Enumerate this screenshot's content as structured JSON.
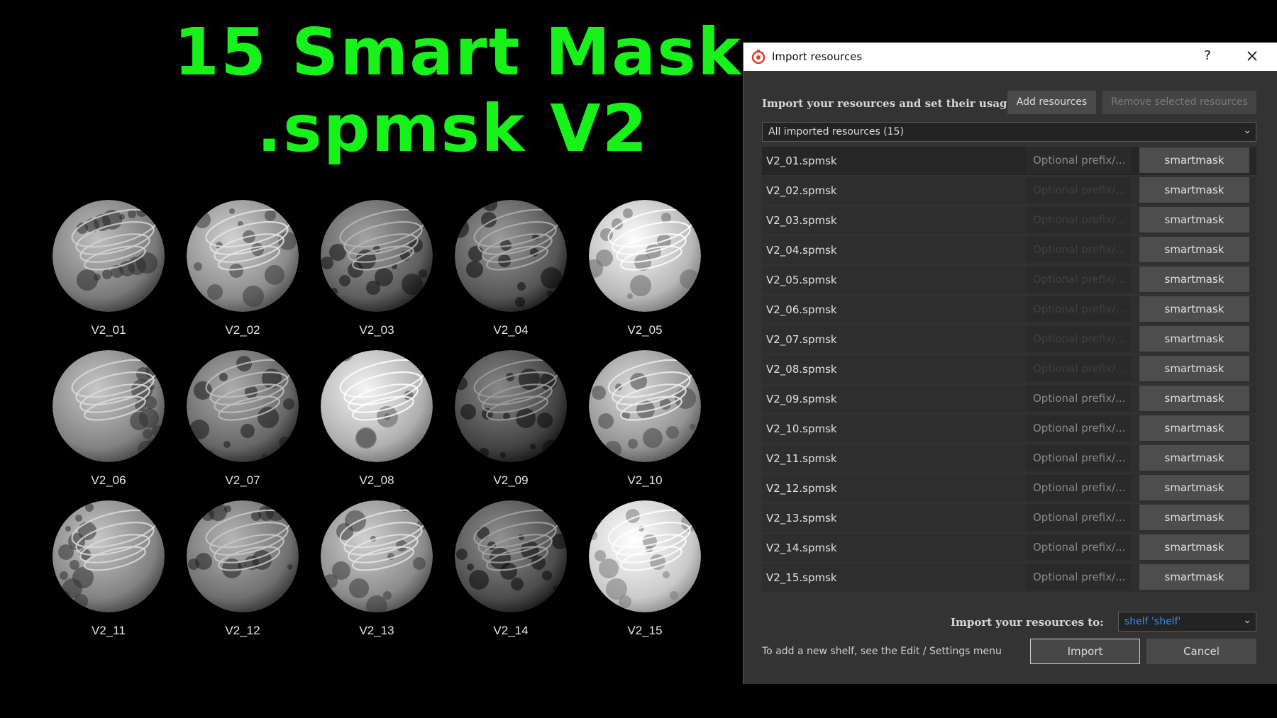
{
  "banner": {
    "line1": "15 Smart Mask",
    "line2": ".spmsk V2",
    "color": "#16f21a"
  },
  "previews": [
    {
      "label": "V2_01",
      "tone": 0.45
    },
    {
      "label": "V2_02",
      "tone": 0.55
    },
    {
      "label": "V2_03",
      "tone": 0.3
    },
    {
      "label": "V2_04",
      "tone": 0.25
    },
    {
      "label": "V2_05",
      "tone": 0.8
    },
    {
      "label": "V2_06",
      "tone": 0.5
    },
    {
      "label": "V2_07",
      "tone": 0.35
    },
    {
      "label": "V2_08",
      "tone": 0.75
    },
    {
      "label": "V2_09",
      "tone": 0.15
    },
    {
      "label": "V2_10",
      "tone": 0.6
    },
    {
      "label": "V2_11",
      "tone": 0.5
    },
    {
      "label": "V2_12",
      "tone": 0.4
    },
    {
      "label": "V2_13",
      "tone": 0.55
    },
    {
      "label": "V2_14",
      "tone": 0.2
    },
    {
      "label": "V2_15",
      "tone": 0.9
    }
  ],
  "dialog": {
    "title": "Import resources",
    "help": "?",
    "header_label": "Import your resources and set their usage",
    "add_button": "Add resources",
    "remove_button": "Remove selected resources",
    "filter_value": "All imported resources (15)",
    "prefix_placeholder": "Optional prefix/...",
    "resources": [
      {
        "name": "V2_01.spmsk",
        "usage": "smartmask"
      },
      {
        "name": "V2_02.spmsk",
        "usage": "smartmask"
      },
      {
        "name": "V2_03.spmsk",
        "usage": "smartmask"
      },
      {
        "name": "V2_04.spmsk",
        "usage": "smartmask"
      },
      {
        "name": "V2_05.spmsk",
        "usage": "smartmask"
      },
      {
        "name": "V2_06.spmsk",
        "usage": "smartmask"
      },
      {
        "name": "V2_07.spmsk",
        "usage": "smartmask"
      },
      {
        "name": "V2_08.spmsk",
        "usage": "smartmask"
      },
      {
        "name": "V2_09.spmsk",
        "usage": "smartmask"
      },
      {
        "name": "V2_10.spmsk",
        "usage": "smartmask"
      },
      {
        "name": "V2_11.spmsk",
        "usage": "smartmask"
      },
      {
        "name": "V2_12.spmsk",
        "usage": "smartmask"
      },
      {
        "name": "V2_13.spmsk",
        "usage": "smartmask"
      },
      {
        "name": "V2_14.spmsk",
        "usage": "smartmask"
      },
      {
        "name": "V2_15.spmsk",
        "usage": "smartmask"
      }
    ],
    "import_to_label": "Import your resources to:",
    "shelf_value": "shelf 'shelf'",
    "hint": "To add a new shelf, see the Edit / Settings menu",
    "import_button": "Import",
    "cancel_button": "Cancel",
    "accent": "#3a8ee6"
  }
}
